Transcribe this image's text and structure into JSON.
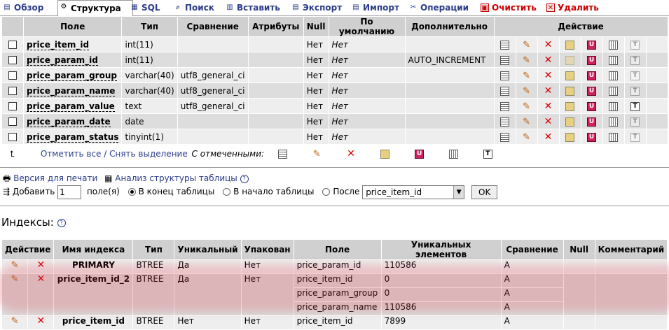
{
  "tabs": [
    {
      "label": "Обзор",
      "icon": "browse-icon",
      "active": false
    },
    {
      "label": "Структура",
      "icon": "structure-icon",
      "active": true
    },
    {
      "label": "SQL",
      "icon": "sql-icon",
      "active": false
    },
    {
      "label": "Поиск",
      "icon": "search-icon",
      "active": false
    },
    {
      "label": "Вставить",
      "icon": "insert-icon",
      "active": false
    },
    {
      "label": "Экспорт",
      "icon": "export-icon",
      "active": false
    },
    {
      "label": "Импорт",
      "icon": "import-icon",
      "active": false
    },
    {
      "label": "Операции",
      "icon": "operations-icon",
      "active": false
    },
    {
      "label": "Очистить",
      "icon": "empty-icon",
      "danger": true
    },
    {
      "label": "Удалить",
      "icon": "drop-icon",
      "danger": true
    }
  ],
  "fields": {
    "headers": [
      "Поле",
      "Тип",
      "Сравнение",
      "Атрибуты",
      "Null",
      "По умолчанию",
      "Дополнительно",
      "Действие"
    ],
    "rows": [
      {
        "name": "price_item_id",
        "type": "int(11)",
        "collation": "",
        "attributes": "",
        "null": "Нет",
        "default": "Нет",
        "extra": ""
      },
      {
        "name": "price_param_id",
        "type": "int(11)",
        "collation": "",
        "attributes": "",
        "null": "Нет",
        "default": "Нет",
        "extra": "AUTO_INCREMENT"
      },
      {
        "name": "price_param_group",
        "type": "varchar(40)",
        "collation": "utf8_general_ci",
        "attributes": "",
        "null": "Нет",
        "default": "Нет",
        "extra": ""
      },
      {
        "name": "price_param_name",
        "type": "varchar(40)",
        "collation": "utf8_general_ci",
        "attributes": "",
        "null": "Нет",
        "default": "Нет",
        "extra": ""
      },
      {
        "name": "price_param_value",
        "type": "text",
        "collation": "utf8_general_ci",
        "attributes": "",
        "null": "Нет",
        "default": "Нет",
        "extra": ""
      },
      {
        "name": "price_param_date",
        "type": "date",
        "collation": "",
        "attributes": "",
        "null": "Нет",
        "default": "Нет",
        "extra": ""
      },
      {
        "name": "price_param_status",
        "type": "tinyint(1)",
        "collation": "",
        "attributes": "",
        "null": "Нет",
        "default": "Нет",
        "extra": ""
      }
    ]
  },
  "check_all": {
    "link": "Отметить все / Снять выделение",
    "with_selected": "С отмеченными:"
  },
  "tools": {
    "print": "Версия для печати",
    "analyze": "Анализ структуры таблицы"
  },
  "add_field": {
    "label": "Добавить",
    "count": "1",
    "unit": "поле(я)",
    "opt_end": "В конец таблицы",
    "opt_begin": "В начало таблицы",
    "opt_after": "После",
    "after_value": "price_item_id",
    "ok": "OK"
  },
  "indexes": {
    "title": "Индексы:",
    "headers": [
      "Действие",
      "Имя индекса",
      "Тип",
      "Уникальный",
      "Упакован",
      "Поле",
      "Уникальных элементов",
      "Сравнение",
      "Null",
      "Комментарий"
    ],
    "rows": [
      {
        "name": "PRIMARY",
        "type": "BTREE",
        "unique": "Да",
        "packed": "Нет",
        "columns": [
          {
            "field": "price_param_id",
            "card": "110586",
            "coll": "A"
          }
        ]
      },
      {
        "name": "price_item_id_2",
        "type": "BTREE",
        "unique": "Да",
        "packed": "Нет",
        "columns": [
          {
            "field": "price_item_id",
            "card": "0",
            "coll": "A"
          },
          {
            "field": "price_param_group",
            "card": "0",
            "coll": "A"
          },
          {
            "field": "price_param_name",
            "card": "110586",
            "coll": "A"
          }
        ]
      },
      {
        "name": "price_item_id",
        "type": "BTREE",
        "unique": "Нет",
        "packed": "Нет",
        "columns": [
          {
            "field": "price_item_id",
            "card": "7899",
            "coll": "A"
          }
        ]
      }
    ]
  }
}
